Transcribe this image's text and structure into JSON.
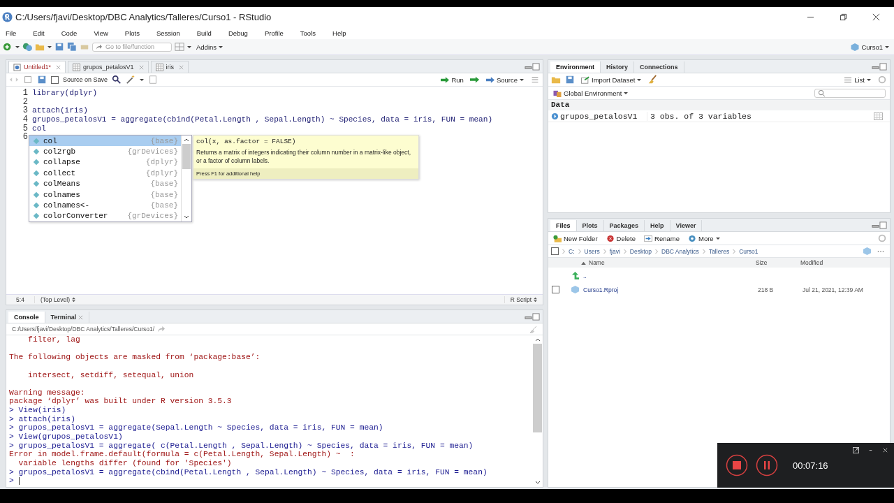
{
  "window": {
    "title": "C:/Users/fjavi/Desktop/DBC Analytics/Talleres/Curso1 - RStudio"
  },
  "menu": [
    "File",
    "Edit",
    "Code",
    "View",
    "Plots",
    "Session",
    "Build",
    "Debug",
    "Profile",
    "Tools",
    "Help"
  ],
  "toolbar": {
    "goto_placeholder": "Go to file/function",
    "addins": "Addins",
    "project": "Curso1"
  },
  "editor": {
    "tabs": [
      {
        "label": "Untitled1*",
        "kind": "script",
        "selected": true
      },
      {
        "label": "grupos_petalosV1",
        "kind": "table",
        "selected": false
      },
      {
        "label": "iris",
        "kind": "table",
        "selected": false
      }
    ],
    "source_on_save": {
      "label": "Source on Save",
      "checked": false
    },
    "run": "Run",
    "source": "Source",
    "lines": [
      {
        "number": "1",
        "code": "library(dplyr)"
      },
      {
        "number": "2"
      },
      {
        "number": "3",
        "code": "attach(iris)"
      },
      {
        "number": "4",
        "code": "grupos_petalosV1 = aggregate(cbind(Petal.Length , Sepal.Length) ~ Species, data = iris, FUN = mean)"
      },
      {
        "number": "5",
        "code": "col"
      },
      {
        "number": "6"
      }
    ],
    "autocomplete": {
      "items": [
        {
          "name": "col",
          "package": "{base}",
          "selected": true
        },
        {
          "name": "col2rgb",
          "package": "{grDevices}",
          "selected": false
        },
        {
          "name": "collapse",
          "package": "{dplyr}",
          "selected": false
        },
        {
          "name": "collect",
          "package": "{dplyr}",
          "selected": false
        },
        {
          "name": "colMeans",
          "package": "{base}",
          "selected": false
        },
        {
          "name": "colnames",
          "package": "{base}",
          "selected": false
        },
        {
          "name": "colnames<-",
          "package": "{base}",
          "selected": false
        },
        {
          "name": "colorConverter",
          "package": "{grDevices}",
          "selected": false
        }
      ],
      "signature": "col(x, as.factor = FALSE)",
      "description": "Returns a matrix of integers indicating their column number in a matrix-like object, or a factor of column labels.",
      "help": "Press F1 for additional help"
    },
    "status": {
      "position": "5:4",
      "scope": "(Top Level)",
      "filetype": "R Script"
    }
  },
  "console": {
    "tabs": [
      {
        "label": "Console",
        "selected": true,
        "closable": false
      },
      {
        "label": "Terminal",
        "selected": false,
        "closable": true
      }
    ],
    "path": "C:/Users/fjavi/Desktop/DBC Analytics/Talleres/Curso1/",
    "lines": [
      {
        "kind": "output",
        "text": "    filter, lag"
      },
      {
        "kind": "blank"
      },
      {
        "kind": "output",
        "text": "The following objects are masked from ‘package:base’:"
      },
      {
        "kind": "blank"
      },
      {
        "kind": "output",
        "text": "    intersect, setdiff, setequal, union"
      },
      {
        "kind": "blank"
      },
      {
        "kind": "output",
        "text": "Warning message:"
      },
      {
        "kind": "output",
        "text": "package ‘dplyr’ was built under R version 3.5.3"
      },
      {
        "kind": "input",
        "text": "> View(iris)"
      },
      {
        "kind": "input",
        "text": "> attach(iris)"
      },
      {
        "kind": "input",
        "text": "> grupos_petalosV1 = aggregate(Sepal.Length ~ Species, data = iris, FUN = mean)"
      },
      {
        "kind": "input",
        "text": "> View(grupos_petalosV1)"
      },
      {
        "kind": "input",
        "text": "> grupos_petalosV1 = aggregate( c(Petal.Length , Sepal.Length) ~ Species, data = iris, FUN = mean)"
      },
      {
        "kind": "output",
        "text": "Error in model.frame.default(formula = c(Petal.Length, Sepal.Length) ~  :"
      },
      {
        "kind": "output",
        "text": "  variable lengths differ (found for 'Species')"
      },
      {
        "kind": "input",
        "text": "> grupos_petalosV1 = aggregate(cbind(Petal.Length , Sepal.Length) ~ Species, data = iris, FUN = mean)"
      },
      {
        "kind": "input",
        "text": ">"
      }
    ]
  },
  "environment": {
    "tabs": [
      {
        "label": "Environment",
        "selected": true
      },
      {
        "label": "History",
        "selected": false
      },
      {
        "label": "Connections",
        "selected": false
      }
    ],
    "import": "Import Dataset",
    "view": "List",
    "scope": "Global Environment",
    "section": "Data",
    "rows": [
      {
        "name": "grupos_petalosV1",
        "value": "3 obs. of 3 variables"
      }
    ]
  },
  "files": {
    "tabs": [
      {
        "label": "Files",
        "selected": true
      },
      {
        "label": "Plots",
        "selected": false
      },
      {
        "label": "Packages",
        "selected": false
      },
      {
        "label": "Help",
        "selected": false
      },
      {
        "label": "Viewer",
        "selected": false
      }
    ],
    "actions": [
      {
        "label": "New Folder",
        "kind": "new-folder"
      },
      {
        "label": "Delete",
        "kind": "delete"
      },
      {
        "label": "Rename",
        "kind": "rename"
      },
      {
        "label": "More",
        "kind": "more"
      }
    ],
    "select_all_checked": false,
    "breadcrumb": [
      "C:",
      "Users",
      "fjavi",
      "Desktop",
      "DBC Analytics",
      "Talleres",
      "Curso1"
    ],
    "columns": {
      "name": "Name",
      "size": "Size",
      "modified": "Modified"
    },
    "rows": [
      {
        "kind": "up",
        "name": ".."
      },
      {
        "kind": "file",
        "name": "Curso1.Rproj",
        "size": "218 B",
        "modified": "Jul 21, 2021, 12:39 AM",
        "checked": false
      }
    ]
  },
  "recorder": {
    "time": "00:07:16"
  }
}
